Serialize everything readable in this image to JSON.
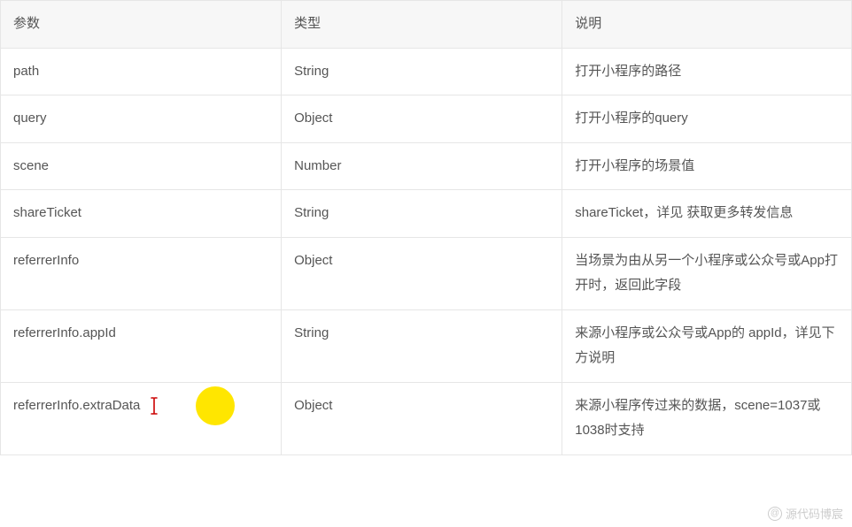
{
  "table": {
    "headers": {
      "param": "参数",
      "type": "类型",
      "desc": "说明"
    },
    "rows": [
      {
        "param": "path",
        "type": "String",
        "desc": "打开小程序的路径"
      },
      {
        "param": "query",
        "type": "Object",
        "desc": "打开小程序的query"
      },
      {
        "param": "scene",
        "type": "Number",
        "desc": "打开小程序的场景值"
      },
      {
        "param": "shareTicket",
        "type": "String",
        "desc": "shareTicket，详见 获取更多转发信息"
      },
      {
        "param": "referrerInfo",
        "type": "Object",
        "desc": "当场景为由从另一个小程序或公众号或App打开时，返回此字段"
      },
      {
        "param": "referrerInfo.appId",
        "type": "String",
        "desc": "来源小程序或公众号或App的 appId，详见下方说明"
      },
      {
        "param": "referrerInfo.extraData",
        "type": "Object",
        "desc": "来源小程序传过来的数据，scene=1037或1038时支持"
      }
    ]
  },
  "cursor_highlight_row_index": 6,
  "watermark": "源代码博宸"
}
